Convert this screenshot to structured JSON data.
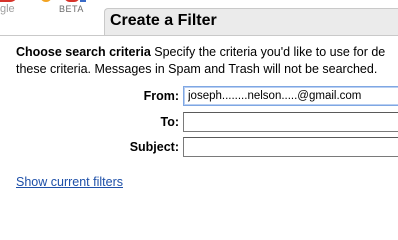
{
  "logo": {
    "word": "gle",
    "badge": "BETA"
  },
  "header": {
    "title": "Create a Filter"
  },
  "criteria": {
    "heading": "Choose search criteria",
    "line1": " Specify the criteria you'd like to use for de",
    "line2": "these criteria. Messages in Spam and Trash will not be searched."
  },
  "form": {
    "from_label": "From:",
    "from_value": "joseph........nelson.....@gmail.com",
    "to_label": "To:",
    "to_value": "",
    "subject_label": "Subject:",
    "subject_value": ""
  },
  "links": {
    "show_current_filters": "Show current filters"
  }
}
